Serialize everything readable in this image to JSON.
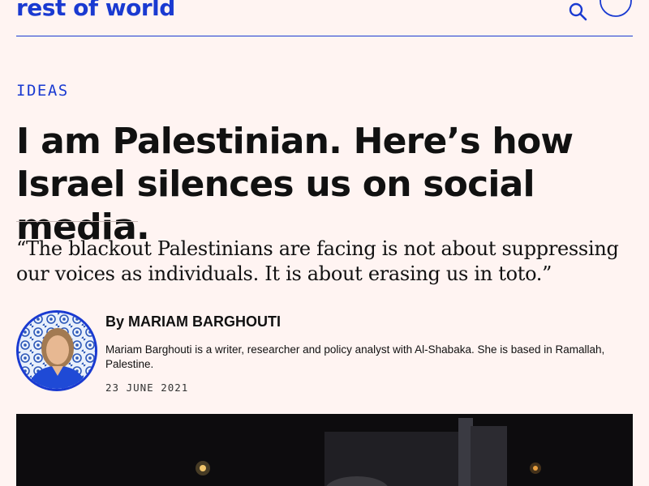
{
  "header": {
    "logo_text": "rest of world",
    "search_icon": "search-icon",
    "menu_icon": "menu-circle-icon",
    "brand_color": "#1a3ad1"
  },
  "article": {
    "section": "IDEAS",
    "headline": "I am Palestinian. Here’s how Israel silences us on social media.",
    "dek": "“The blackout Palestinians are facing is not about suppressing our voices as individuals. It is about erasing us in toto.”",
    "byline_prefix": "By",
    "author": "MARIAM BARGHOUTI",
    "bio": "Mariam Barghouti is a writer, researcher and policy analyst with Al-Shabaka. She is based in Ramallah, Palestine.",
    "date": "23 JUNE 2021"
  },
  "colors": {
    "background": "#fff4f2",
    "accent": "#1a3ad1",
    "text": "#111111"
  }
}
